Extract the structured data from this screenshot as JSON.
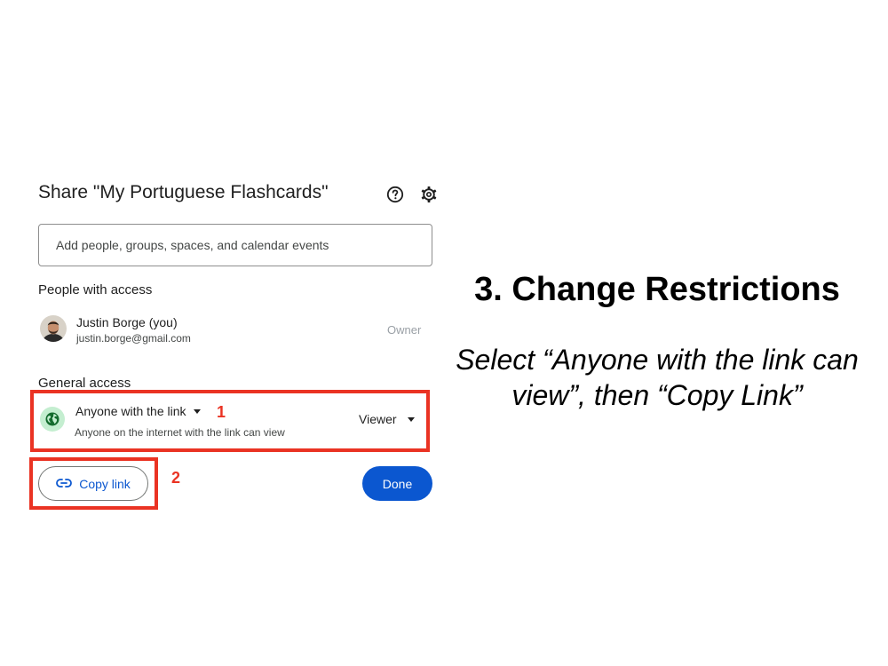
{
  "dialog": {
    "title": "Share \"My Portuguese Flashcards\"",
    "help_icon": "help-circle-icon",
    "settings_icon": "gear-icon",
    "add_people_placeholder": "Add people, groups, spaces, and calendar events",
    "people_heading": "People with access",
    "people": [
      {
        "name": "Justin Borge (you)",
        "email": "justin.borge@gmail.com",
        "role": "Owner"
      }
    ],
    "general_access_heading": "General access",
    "general_access": {
      "icon": "globe-icon",
      "setting": "Anyone with the link",
      "description": "Anyone on the internet with the link can view",
      "role": "Viewer"
    },
    "copy_link_label": "Copy link",
    "copy_link_icon": "link-icon",
    "done_label": "Done"
  },
  "annotations": {
    "step_1": "1",
    "step_2": "2",
    "highlight_color": "#ea3323"
  },
  "instruction": {
    "heading": "3. Change Restrictions",
    "text": "Select “Anyone with the link can view”, then “Copy Link”"
  },
  "colors": {
    "primary": "#0b57d0",
    "globe_bg": "#c4eed0",
    "globe_fg": "#146c2e"
  }
}
